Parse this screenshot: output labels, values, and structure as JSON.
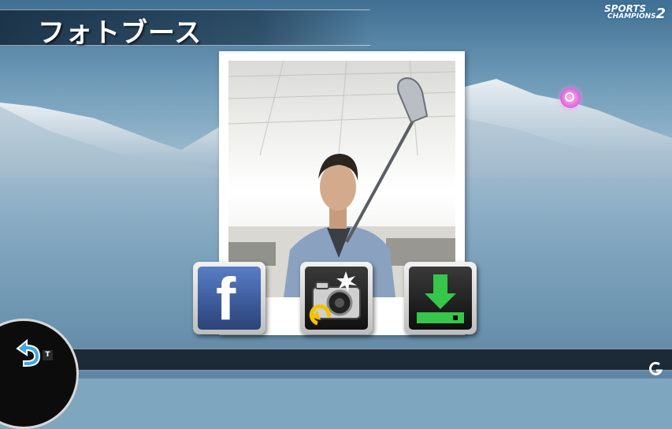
{
  "screen": {
    "title": "フォトブース"
  },
  "logo": {
    "line1": "SPORTS",
    "line2": "CHAMPIONS",
    "number": "2"
  },
  "actions": [
    {
      "id": "facebook",
      "label": "f",
      "icon": "facebook-icon",
      "color": "#3b5998"
    },
    {
      "id": "retake",
      "icon": "camera-retake-icon",
      "color": "#f2c200"
    },
    {
      "id": "save",
      "icon": "download-icon",
      "color": "#36c64a"
    }
  ],
  "controls": {
    "back_icon": "back-arrow-icon",
    "back_key": "T"
  },
  "colors": {
    "pointer": "#e673e2",
    "save_green": "#36c64a",
    "retake_yellow": "#f2c200"
  }
}
